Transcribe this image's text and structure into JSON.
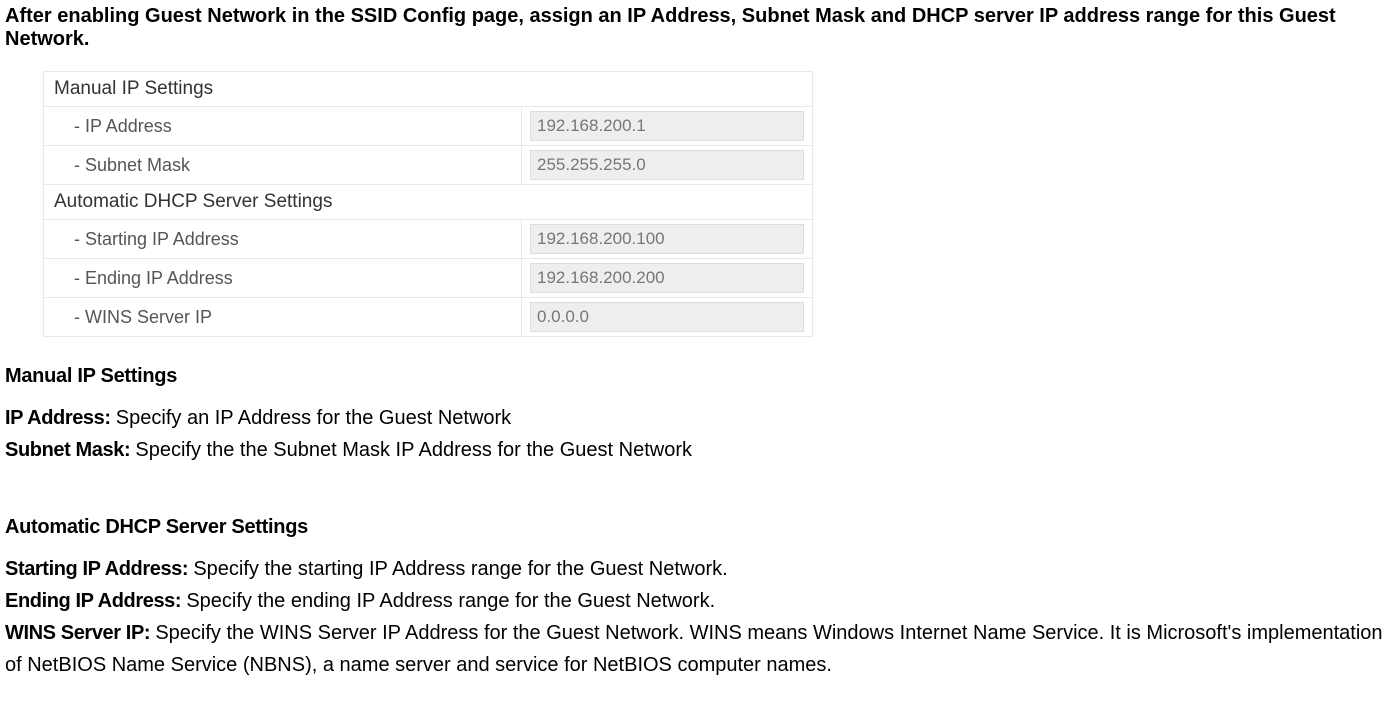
{
  "intro": "After enabling Guest Network in the SSID Config page, assign an IP Address, Subnet Mask and DHCP server IP address range for this Guest Network.",
  "table": {
    "manualHeader": "Manual IP Settings",
    "ipAddressLabel": "- IP Address",
    "ipAddressValue": "192.168.200.1",
    "subnetLabel": "- Subnet Mask",
    "subnetValue": "255.255.255.0",
    "dhcpHeader": "Automatic DHCP Server Settings",
    "startIPLabel": "- Starting IP Address",
    "startIPValue": "192.168.200.100",
    "endIPLabel": "- Ending IP Address",
    "endIPValue": "192.168.200.200",
    "winsLabel": "- WINS Server IP",
    "winsValue": "0.0.0.0"
  },
  "sectionManual": "Manual IP Settings",
  "ipTerm": "IP Address: ",
  "ipDesc": "Specify an IP Address for the Guest Network",
  "subnetTerm": "Subnet Mask: ",
  "subnetDesc": "Specify the the Subnet Mask IP Address for the Guest Network",
  "sectionDhcp": "Automatic DHCP Server Settings",
  "startTerm": "Starting IP Address: ",
  "startDesc": "Specify the starting IP Address range for the Guest Network.",
  "endTerm": "Ending IP Address: ",
  "endDesc": "Specify the ending IP Address range for the Guest Network.",
  "winsTerm": "WINS Server IP: ",
  "winsDesc": "Specify the WINS Server IP Address for the Guest Network. WINS means Windows Internet Name Service. It is Microsoft's implementation of NetBIOS Name Service (NBNS), a name server and service for NetBIOS computer names."
}
